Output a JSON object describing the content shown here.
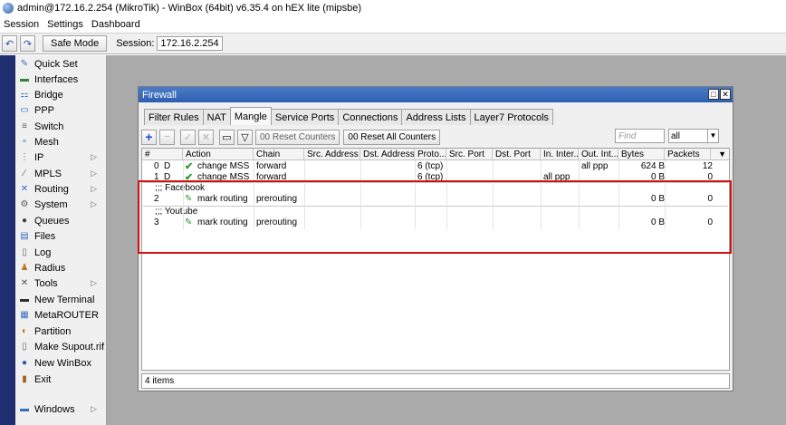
{
  "window": {
    "title": "admin@172.16.2.254 (MikroTik) - WinBox (64bit) v6.35.4 on hEX lite (mipsbe)"
  },
  "menu": [
    "Session",
    "Settings",
    "Dashboard"
  ],
  "toolbar": {
    "undo": "↶",
    "redo": "↷",
    "safe_mode": "Safe Mode",
    "session_label": "Session:",
    "session_value": "172.16.2.254"
  },
  "sidebar": [
    {
      "label": "Quick Set",
      "icon": "wand-icon",
      "glyph": "✎",
      "color": "#3a6fc0",
      "sub": false
    },
    {
      "label": "Interfaces",
      "icon": "interfaces-icon",
      "glyph": "▬",
      "color": "#2a8a3a",
      "sub": false
    },
    {
      "label": "Bridge",
      "icon": "bridge-icon",
      "glyph": "⚏",
      "color": "#3a6fc0",
      "sub": false
    },
    {
      "label": "PPP",
      "icon": "ppp-icon",
      "glyph": "▭",
      "color": "#3a6fc0",
      "sub": false
    },
    {
      "label": "Switch",
      "icon": "switch-icon",
      "glyph": "≡",
      "color": "#606060",
      "sub": false
    },
    {
      "label": "Mesh",
      "icon": "mesh-icon",
      "glyph": "∘",
      "color": "#3a6fc0",
      "sub": false
    },
    {
      "label": "IP",
      "icon": "ip-icon",
      "glyph": "⋮",
      "color": "#606060",
      "sub": true
    },
    {
      "label": "MPLS",
      "icon": "mpls-icon",
      "glyph": "⁄",
      "color": "#606060",
      "sub": true
    },
    {
      "label": "Routing",
      "icon": "routing-icon",
      "glyph": "✕",
      "color": "#3a6fc0",
      "sub": true
    },
    {
      "label": "System",
      "icon": "system-icon",
      "glyph": "⚙",
      "color": "#606060",
      "sub": true
    },
    {
      "label": "Queues",
      "icon": "queues-icon",
      "glyph": "●",
      "color": "#404040",
      "sub": false
    },
    {
      "label": "Files",
      "icon": "files-icon",
      "glyph": "▤",
      "color": "#3a6fc0",
      "sub": false
    },
    {
      "label": "Log",
      "icon": "log-icon",
      "glyph": "▯",
      "color": "#606060",
      "sub": false
    },
    {
      "label": "Radius",
      "icon": "radius-icon",
      "glyph": "♟",
      "color": "#c07020",
      "sub": false
    },
    {
      "label": "Tools",
      "icon": "tools-icon",
      "glyph": "✕",
      "color": "#505050",
      "sub": true
    },
    {
      "label": "New Terminal",
      "icon": "terminal-icon",
      "glyph": "▬",
      "color": "#303030",
      "sub": false
    },
    {
      "label": "MetaROUTER",
      "icon": "metarouter-icon",
      "glyph": "▦",
      "color": "#3a6fc0",
      "sub": false
    },
    {
      "label": "Partition",
      "icon": "partition-icon",
      "glyph": "◐",
      "color": "#d06020",
      "sub": false
    },
    {
      "label": "Make Supout.rif",
      "icon": "document-icon",
      "glyph": "▯",
      "color": "#606060",
      "sub": false
    },
    {
      "label": "New WinBox",
      "icon": "winbox-icon",
      "glyph": "●",
      "color": "#2a5fa8",
      "sub": false
    },
    {
      "label": "Exit",
      "icon": "exit-icon",
      "glyph": "▮",
      "color": "#a06020",
      "sub": false
    },
    {
      "label": "Windows",
      "icon": "windows-icon",
      "glyph": "▬",
      "color": "#3a6fc0",
      "sub": true
    }
  ],
  "firewall": {
    "title": "Firewall",
    "tabs": [
      "Filter Rules",
      "NAT",
      "Mangle",
      "Service Ports",
      "Connections",
      "Address Lists",
      "Layer7 Protocols"
    ],
    "active_tab": "Mangle",
    "reset_counters": "00 Reset Counters",
    "reset_all_counters": "00 Reset All Counters",
    "find_placeholder": "Find",
    "filter_value": "all",
    "columns": [
      "#",
      "Action",
      "Chain",
      "Src. Address",
      "Dst. Address",
      "Proto...",
      "Src. Port",
      "Dst. Port",
      "In. Inter...",
      "Out. Int...",
      "Bytes",
      "Packets"
    ],
    "rows": [
      {
        "num": "0",
        "flag": "D",
        "action": "change MSS",
        "chain": "forward",
        "proto": "6 (tcp)",
        "in_iface": "",
        "out_iface": "all ppp",
        "bytes": "624 B",
        "packets": "12"
      },
      {
        "num": "1",
        "flag": "D",
        "action": "change MSS",
        "chain": "forward",
        "proto": "6 (tcp)",
        "in_iface": "all ppp",
        "out_iface": "",
        "bytes": "0 B",
        "packets": "0"
      }
    ],
    "groups": [
      {
        "comment": ";;; Facebook",
        "num": "2",
        "action": "mark routing",
        "chain": "prerouting",
        "bytes": "0 B",
        "packets": "0"
      },
      {
        "comment": ";;; Youtube",
        "num": "3",
        "action": "mark routing",
        "chain": "prerouting",
        "bytes": "0 B",
        "packets": "0"
      }
    ],
    "status": "4 items"
  },
  "colors": {
    "accent_title": "#3a6fc0",
    "highlight": "#d21010",
    "workspace": "#aaaaaa",
    "left_strip": "#1e2e6e"
  }
}
